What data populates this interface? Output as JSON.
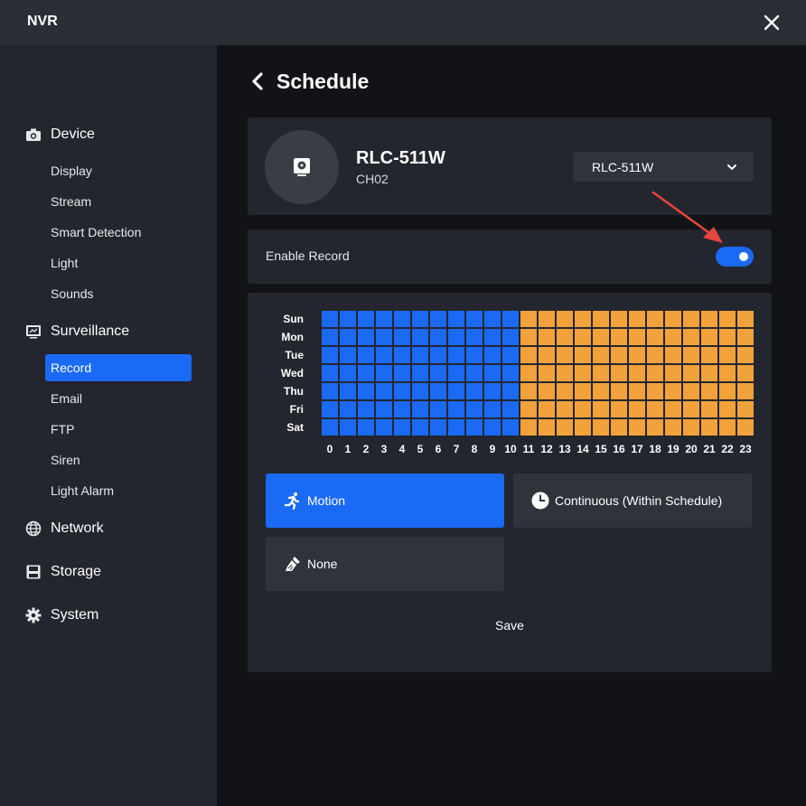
{
  "window": {
    "title": "NVR"
  },
  "sidebar": {
    "sections": [
      {
        "label": "Device",
        "icon": "camera-icon"
      },
      {
        "label": "Surveillance",
        "icon": "monitor-icon"
      },
      {
        "label": "Network",
        "icon": "globe-icon"
      },
      {
        "label": "Storage",
        "icon": "floppy-disk-icon"
      },
      {
        "label": "System",
        "icon": "gear-icon"
      }
    ],
    "device_items": [
      "Display",
      "Stream",
      "Smart Detection",
      "Light",
      "Sounds"
    ],
    "surveillance_items": [
      "Record",
      "Email",
      "FTP",
      "Siren",
      "Light Alarm"
    ],
    "active_item": "Record"
  },
  "page": {
    "title": "Schedule"
  },
  "camera": {
    "name": "RLC-511W",
    "channel": "CH02",
    "selected": "RLC-511W"
  },
  "record": {
    "enable_label": "Enable Record",
    "enabled": true
  },
  "schedule": {
    "days": [
      "Sun",
      "Mon",
      "Tue",
      "Wed",
      "Thu",
      "Fri",
      "Sat"
    ],
    "hours": [
      "0",
      "1",
      "2",
      "3",
      "4",
      "5",
      "6",
      "7",
      "8",
      "9",
      "10",
      "11",
      "12",
      "13",
      "14",
      "15",
      "16",
      "17",
      "18",
      "19",
      "20",
      "21",
      "22",
      "23"
    ],
    "motion_hours_end": 10,
    "colors": {
      "motion": "#1a6af5",
      "continuous": "#f2a23b"
    }
  },
  "modes": {
    "motion": "Motion",
    "continuous": "Continuous (Within Schedule)",
    "none": "None",
    "active": "Motion"
  },
  "actions": {
    "save": "Save"
  },
  "colors": {
    "accent": "#1a6af5",
    "annotation_arrow": "#e8453c"
  }
}
